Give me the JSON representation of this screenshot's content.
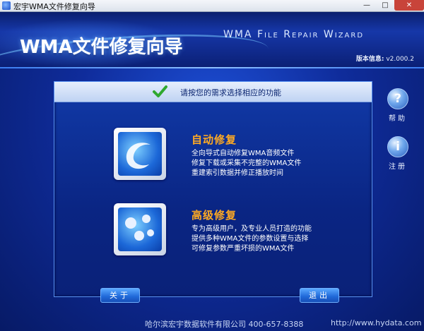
{
  "window": {
    "title": "宏宇WMA文件修复向导",
    "minimize": "—",
    "maximize": "□",
    "close": "✕"
  },
  "header": {
    "app_title": "WMA文件修复向导",
    "subtitle": "WMA File Repair Wizard",
    "version_label": "版本信息:",
    "version_value": "v2.000.2"
  },
  "panel": {
    "title": "请按您的需求选择相应的功能",
    "options": [
      {
        "title": "自动修复",
        "lines": [
          "全向导式自动修复WMA音频文件",
          "修复下载或采集不完整的WMA文件",
          "重建索引数据并修正播放时间"
        ]
      },
      {
        "title": "高级修复",
        "lines": [
          "专为高级用户，及专业人员打造的功能",
          "提供多种WMA文件的参数设置与选择",
          "可修复参数严重坏损的WMA文件"
        ]
      }
    ]
  },
  "buttons": {
    "about": "关于",
    "exit": "退出"
  },
  "side": {
    "help_label": "帮助",
    "register_label": "注册",
    "help_glyph": "?",
    "register_glyph": "i"
  },
  "footer": {
    "company": "哈尔滨宏宇数据软件有限公司 400-657-8388",
    "url": "http://www.hydata.com"
  },
  "colors": {
    "accent": "#ffaa22",
    "background": "#0f2c9b"
  }
}
